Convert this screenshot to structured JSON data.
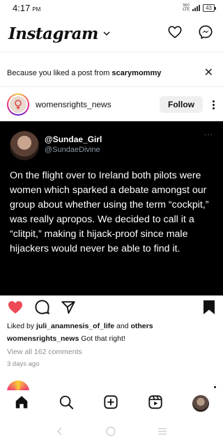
{
  "status_bar": {
    "time": "4:17",
    "ampm": "PM",
    "network_top": "Vo)",
    "network_bottom": "LTE",
    "battery": "43"
  },
  "header": {
    "logo": "Instagram",
    "icons": [
      "chevron-down-icon",
      "heart-icon",
      "messenger-icon"
    ]
  },
  "suggestion": {
    "prefix": "Because you liked a post from ",
    "account": "scarymommy"
  },
  "post": {
    "username": "womensrights_news",
    "follow_label": "Follow",
    "tweet": {
      "display_name": "@Sundae_Girl",
      "handle": "@SundaeDivine",
      "more": "···",
      "text": "On the flight over to Ireland both pilots were women which sparked a debate amongst our group about whether using the term “cockpit,” was really apropos. We decided to call it a “clitpit,” making it hijack-proof since male hijackers would never be able to find it."
    },
    "likes": {
      "prefix": "Liked by ",
      "user": "juli_anamnesis_of_life",
      "middle": " and ",
      "suffix": "others"
    },
    "caption": {
      "user": "womensrights_news",
      "text": " Got that right!"
    },
    "comments_link": "View all 162 comments",
    "time_ago": "3 days ago",
    "liked": true
  },
  "colors": {
    "like_red": "#ed4956",
    "tweet_bg": "#000000",
    "handle_gray": "#8b98a5"
  },
  "bottom_nav": [
    "home-icon",
    "search-icon",
    "new-post-icon",
    "reels-icon",
    "profile-avatar"
  ],
  "system_nav": [
    "back-icon",
    "home-circle-icon",
    "menu-icon"
  ]
}
